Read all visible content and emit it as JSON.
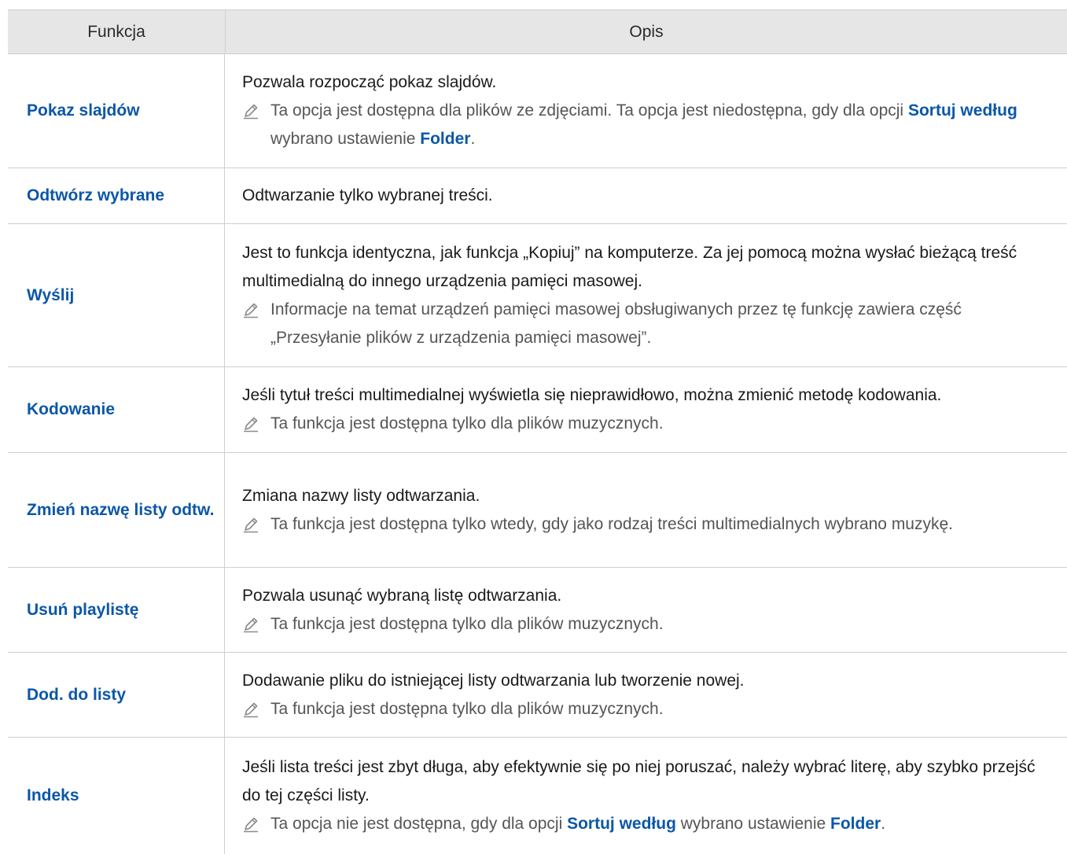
{
  "header": {
    "col1": "Funkcja",
    "col2": "Opis"
  },
  "rows": [
    {
      "func": "Pokaz slajdów",
      "desc": "Pozwala rozpocząć pokaz slajdów.",
      "note": {
        "t1": "Ta opcja jest dostępna dla plików ze zdjęciami. Ta opcja jest niedostępna, gdy dla opcji ",
        "k1": "Sortuj według",
        "t2": " wybrano ustawienie ",
        "k2": "Folder",
        "t3": "."
      }
    },
    {
      "func": "Odtwórz wybrane",
      "desc": "Odtwarzanie tylko wybranej treści."
    },
    {
      "func": "Wyślij",
      "desc": "Jest to funkcja identyczna, jak funkcja „Kopiuj” na komputerze. Za jej pomocą można wysłać bieżącą treść multimedialną do innego urządzenia pamięci masowej.",
      "note": "Informacje na temat urządzeń pamięci masowej obsługiwanych przez tę funkcję zawiera część „Przesyłanie plików z urządzenia pamięci masowej”."
    },
    {
      "func": "Kodowanie",
      "desc": "Jeśli tytuł treści multimedialnej wyświetla się nieprawidłowo, można zmienić metodę kodowania.",
      "note": "Ta funkcja jest dostępna tylko dla plików muzycznych."
    },
    {
      "func": "Zmień nazwę listy odtw.",
      "desc": "Zmiana nazwy listy odtwarzania.",
      "note": "Ta funkcja jest dostępna tylko wtedy, gdy jako rodzaj treści multimedialnych wybrano muzykę."
    },
    {
      "func": "Usuń playlistę",
      "desc": "Pozwala usunąć wybraną listę odtwarzania.",
      "note": "Ta funkcja jest dostępna tylko dla plików muzycznych."
    },
    {
      "func": "Dod. do listy",
      "desc": "Dodawanie pliku do istniejącej listy odtwarzania lub tworzenie nowej.",
      "note": "Ta funkcja jest dostępna tylko dla plików muzycznych."
    },
    {
      "func": "Indeks",
      "desc": "Jeśli lista treści jest zbyt długa, aby efektywnie się po niej poruszać, należy wybrać literę, aby szybko przejść do tej części listy.",
      "note": {
        "t1": "Ta opcja nie jest dostępna, gdy dla opcji ",
        "k1": "Sortuj według",
        "t2": " wybrano ustawienie ",
        "k2": "Folder",
        "t3": "."
      }
    }
  ],
  "icons": {
    "note": "pencil-note-icon"
  },
  "colors": {
    "accent": "#0b57a8",
    "header_bg": "#e6e6e6",
    "note_text": "#555555",
    "border": "#cfcfcf"
  }
}
